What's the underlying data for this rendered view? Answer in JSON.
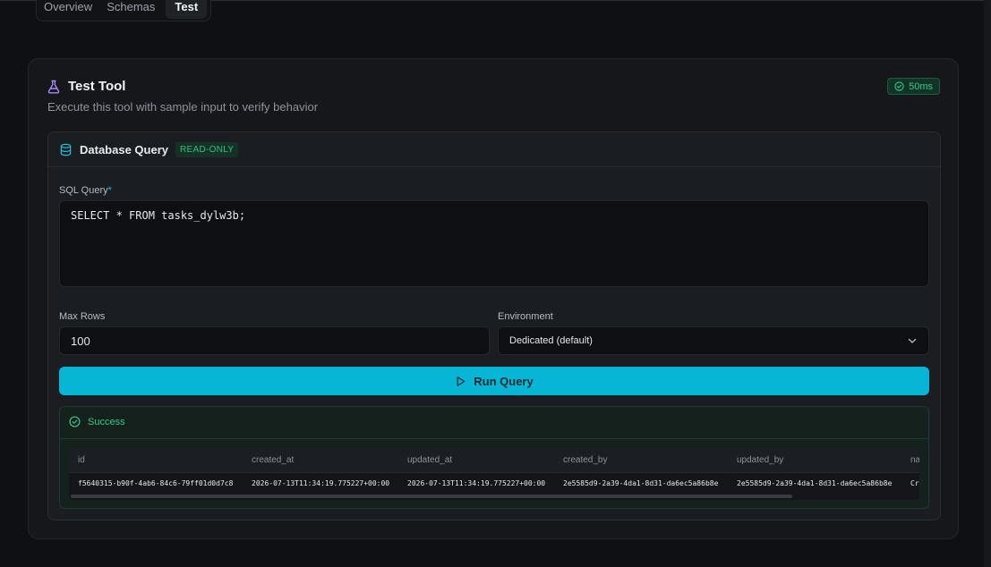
{
  "tabs": [
    {
      "label": "Overview"
    },
    {
      "label": "Schemas"
    },
    {
      "label": "Test"
    }
  ],
  "card": {
    "title": "Test Tool",
    "subtitle": "Execute this tool with sample input to verify behavior",
    "timing": "50ms"
  },
  "panel": {
    "title": "Database Query",
    "badge": "READ-ONLY"
  },
  "form": {
    "sql_label": "SQL Query",
    "required_mark": "*",
    "sql_value": "SELECT * FROM tasks_dylw3b;",
    "max_rows_label": "Max Rows",
    "max_rows_value": "100",
    "environment_label": "Environment",
    "environment_value": "Dedicated (default)",
    "run_label": "Run Query"
  },
  "result": {
    "status": "Success",
    "columns": [
      "id",
      "created_at",
      "updated_at",
      "created_by",
      "updated_by",
      "na"
    ],
    "rows": [
      [
        "f5640315-b90f-4ab6-84c6-79ff01d0d7c8",
        "2026-07-13T11:34:19.775227+00:00",
        "2026-07-13T11:34:19.775227+00:00",
        "2e5585d9-2a39-4da1-8d31-da6ec5a86b8e",
        "2e5585d9-2a39-4da1-8d31-da6ec5a86b8e",
        "Cr"
      ]
    ]
  },
  "colors": {
    "accent": "#06b6d4",
    "success": "#35c98a",
    "icon_purple": "#a78bfa"
  },
  "icons": {
    "tab_icon": "flask-icon",
    "timing_icon": "check-circle-icon",
    "panel_icon": "database-icon",
    "run_icon": "play-icon",
    "environment_icon": "chevron-down-icon",
    "result_icon": "check-circle-icon"
  }
}
